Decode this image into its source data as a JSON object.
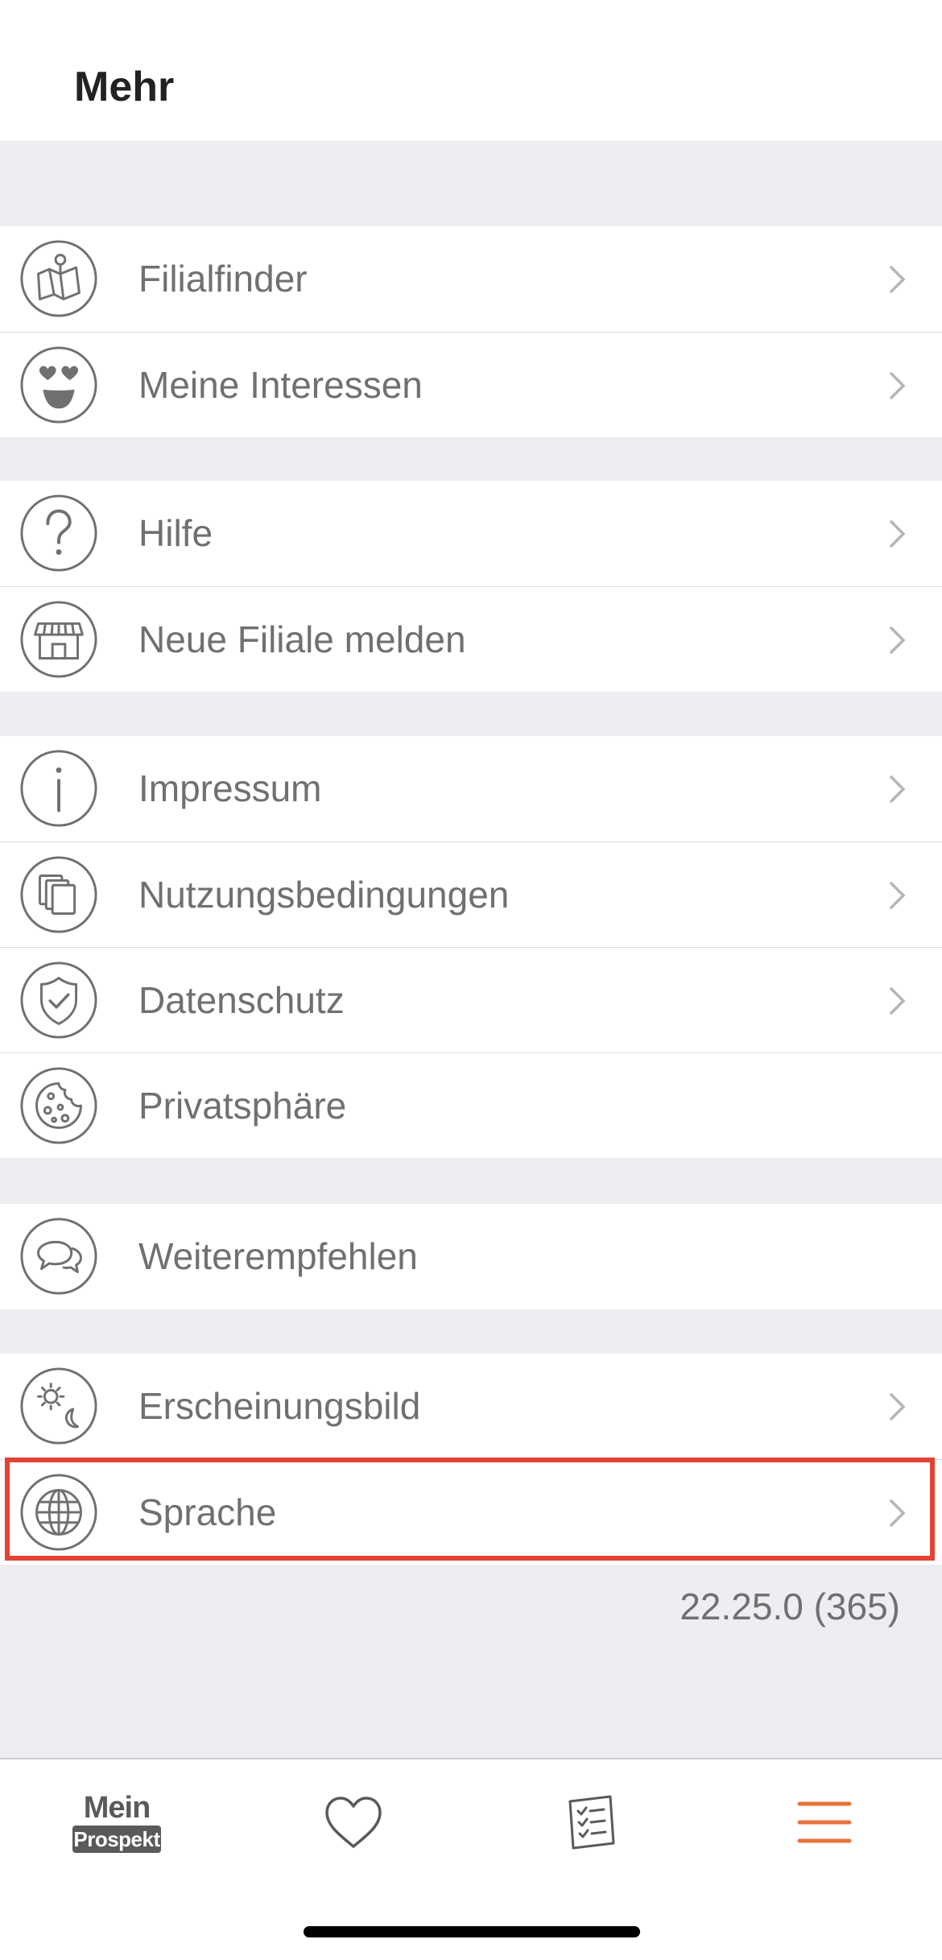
{
  "header": {
    "title": "Mehr"
  },
  "groups": [
    {
      "items": [
        {
          "label": "Filialfinder",
          "icon": "map-pin-icon",
          "chevron": true
        },
        {
          "label": "Meine Interessen",
          "icon": "heart-eyes-emoji-icon",
          "chevron": true
        }
      ]
    },
    {
      "items": [
        {
          "label": "Hilfe",
          "icon": "question-mark-icon",
          "chevron": true
        },
        {
          "label": "Neue Filiale melden",
          "icon": "store-icon",
          "chevron": true
        }
      ]
    },
    {
      "items": [
        {
          "label": "Impressum",
          "icon": "info-icon",
          "chevron": true
        },
        {
          "label": "Nutzungsbedingungen",
          "icon": "documents-icon",
          "chevron": true
        },
        {
          "label": "Datenschutz",
          "icon": "shield-check-icon",
          "chevron": true
        },
        {
          "label": "Privatsphäre",
          "icon": "cookie-icon",
          "chevron": false
        }
      ]
    },
    {
      "items": [
        {
          "label": "Weiterempfehlen",
          "icon": "chat-bubbles-icon",
          "chevron": false
        }
      ]
    },
    {
      "items": [
        {
          "label": "Erscheinungsbild",
          "icon": "sun-moon-icon",
          "chevron": true
        },
        {
          "label": "Sprache",
          "icon": "globe-icon",
          "chevron": true
        }
      ]
    }
  ],
  "version": "22.25.0 (365)",
  "tabbar": {
    "logo_top": "Mein",
    "logo_bottom": "Prospekt",
    "tabs": [
      {
        "name": "mein-prospekt",
        "icon": "mein-prospekt-logo"
      },
      {
        "name": "favorites",
        "icon": "heart-icon"
      },
      {
        "name": "shopping-list",
        "icon": "checklist-icon"
      },
      {
        "name": "more",
        "icon": "hamburger-menu-icon",
        "active": true
      }
    ]
  },
  "colors": {
    "accent": "#e8733a",
    "text": "#707070",
    "background": "#ededf2",
    "highlight": "#e34234"
  }
}
